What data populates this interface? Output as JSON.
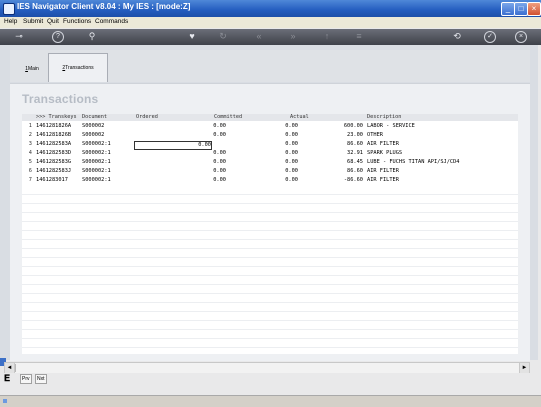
{
  "window": {
    "title": "IES Navigator Client v8.04 : My IES :       [mode:Z]"
  },
  "menu": [
    "Help",
    "Submit",
    "Quit",
    "Functions",
    "Commands"
  ],
  "toolbar": {
    "icons": [
      "key-icon",
      "help-icon",
      "search-icon",
      "heart-icon",
      "refresh-icon",
      "back-double-icon",
      "forward-double-icon",
      "up-icon",
      "list-icon",
      "save-icon",
      "check-icon",
      "close-icon"
    ]
  },
  "tabs": [
    {
      "key": "1",
      "label": "Main"
    },
    {
      "key": "2",
      "label": "Transactions"
    }
  ],
  "heading": "Transactions",
  "grid": {
    "columns": [
      ">>> Transkeys",
      "Document",
      "Ordered",
      "Committed",
      "Actual",
      "Description"
    ],
    "rows": [
      {
        "num": "1",
        "transkey": "1461281826A",
        "document": "S000002",
        "ordered": "",
        "committed": "0.00",
        "actual": "0.00",
        "amount": "600.00",
        "description": "LABOR - SERVICE"
      },
      {
        "num": "2",
        "transkey": "1461281826B",
        "document": "S000002",
        "ordered": "",
        "committed": "0.00",
        "actual": "0.00",
        "amount": "23.00",
        "description": "OTHER"
      },
      {
        "num": "3",
        "transkey": "1461282583A",
        "document": "S000002:1",
        "ordered": "",
        "committed": "0.00",
        "actual": "0.00",
        "amount": "86.60",
        "description": "AIR FILTER"
      },
      {
        "num": "4",
        "transkey": "1461282583D",
        "document": "S000002:1",
        "ordered": "",
        "committed": "0.00",
        "actual": "0.00",
        "amount": "32.91",
        "description": "SPARK PLUGS"
      },
      {
        "num": "5",
        "transkey": "1461282583G",
        "document": "S000002:1",
        "ordered": "",
        "committed": "0.00",
        "actual": "0.00",
        "amount": "68.45",
        "description": "LUBE - FUCHS TITAN API/SJ/CD4"
      },
      {
        "num": "6",
        "transkey": "1461282583J",
        "document": "S000002:1",
        "ordered": "",
        "committed": "0.00",
        "actual": "0.00",
        "amount": "86.60",
        "description": "AIR FILTER"
      },
      {
        "num": "7",
        "transkey": "1461283017",
        "document": "S000002:1",
        "ordered": "",
        "committed": "0.00",
        "actual": "0.00",
        "amount": "-86.60",
        "description": "AIR FILTER"
      }
    ]
  },
  "bottom_nav": {
    "prev": "Prv",
    "next": "Nxt"
  }
}
